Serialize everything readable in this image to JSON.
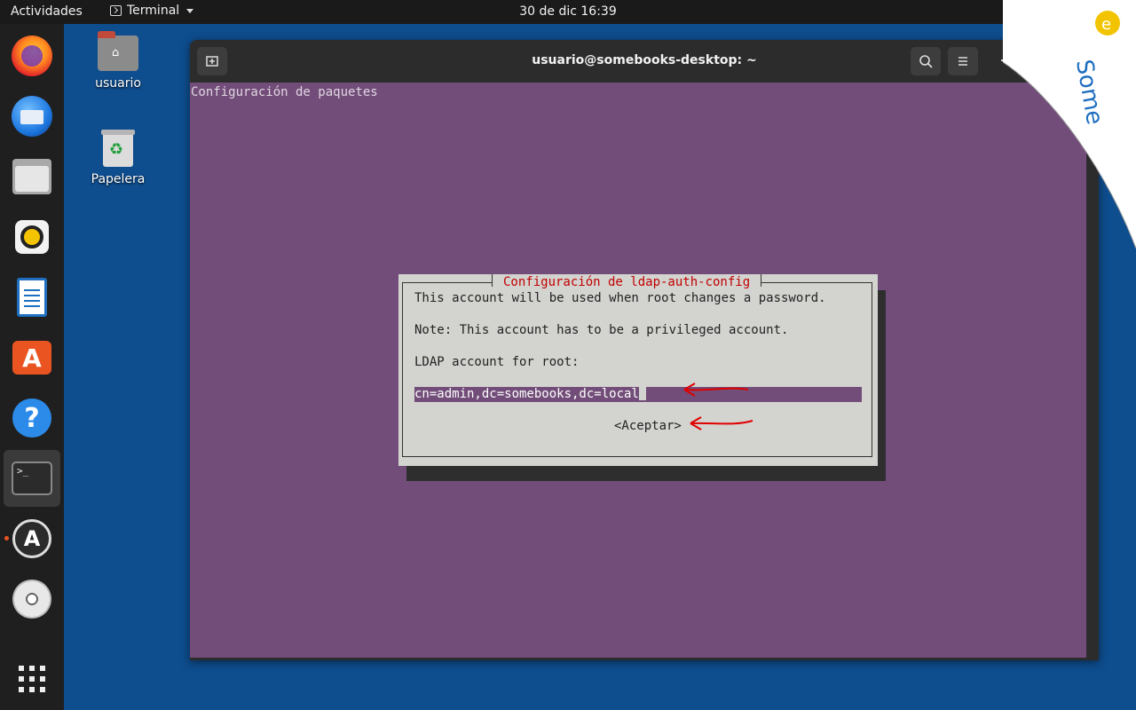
{
  "topbar": {
    "activities": "Actividades",
    "app_menu": "Terminal",
    "clock": "30 de dic  16:39"
  },
  "dock": {
    "items": [
      "firefox-icon",
      "thunderbird-icon",
      "files-icon",
      "rhythmbox-icon",
      "libreoffice-writer-icon",
      "software-icon",
      "help-icon",
      "terminal-icon",
      "software-updater-icon",
      "dvd-icon",
      "show-apps-icon"
    ]
  },
  "desktop": {
    "home_label": "usuario",
    "trash_label": "Papelera"
  },
  "window": {
    "title": "usuario@somebooks-desktop: ~",
    "header": "Configuración de paquetes"
  },
  "dialog": {
    "title": "Configuración de ldap-auth-config",
    "line1": "This account will be used when root changes a password.",
    "line2": "Note: This account has to be a privileged account.",
    "line3": "LDAP account for root:",
    "field_value": "cn=admin,dc=somebooks,dc=local",
    "ok_label": "<Aceptar>"
  },
  "colors": {
    "terminal_bg": "#724d79",
    "dialog_bg": "#d3d3d0",
    "dialog_title": "#c00000",
    "accent": "#e95420",
    "annotation_arrow": "#e00000"
  }
}
